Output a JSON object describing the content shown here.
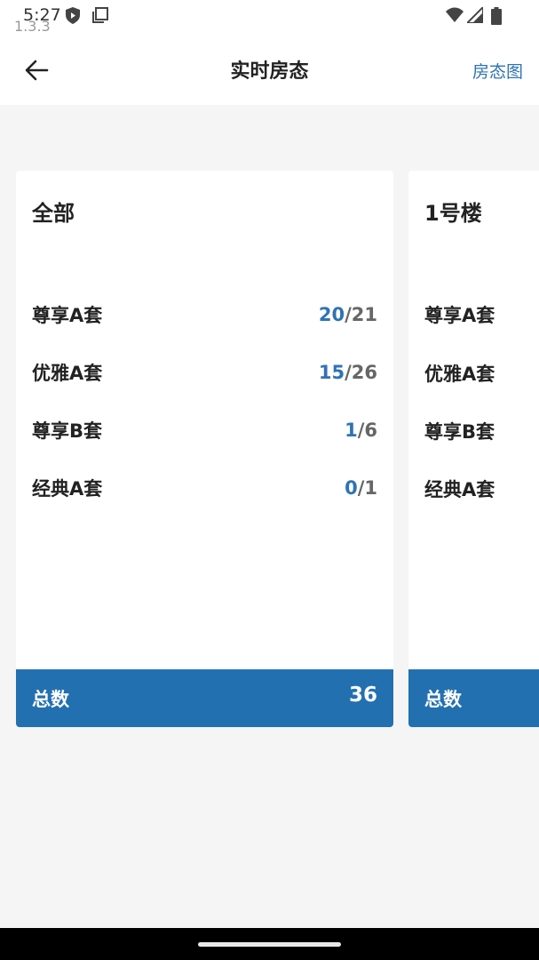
{
  "status_bar": {
    "time": "5:27",
    "version": "1.3.3",
    "icons": [
      "shield-play-icon",
      "screenshot-icon",
      "wifi-icon",
      "signal-icon",
      "battery-icon"
    ]
  },
  "app_bar": {
    "title": "实时房态",
    "right_action": "房态图",
    "back_icon": "arrow-left-icon"
  },
  "colors": {
    "accent": "#2f73b4",
    "footer": "#2370b1",
    "background": "#f5f5f5"
  },
  "cards": [
    {
      "title": "全部",
      "rows": [
        {
          "label": "尊享A套",
          "available": "20",
          "total": "/21"
        },
        {
          "label": "优雅A套",
          "available": "15",
          "total": "/26"
        },
        {
          "label": "尊享B套",
          "available": "1",
          "total": "/6"
        },
        {
          "label": "经典A套",
          "available": "0",
          "total": "/1"
        }
      ],
      "footer_label": "总数",
      "footer_value": "36"
    },
    {
      "title": "1号楼",
      "rows": [
        {
          "label": "尊享A套"
        },
        {
          "label": "优雅A套"
        },
        {
          "label": "尊享B套"
        },
        {
          "label": "经典A套"
        }
      ],
      "footer_label": "总数"
    }
  ]
}
